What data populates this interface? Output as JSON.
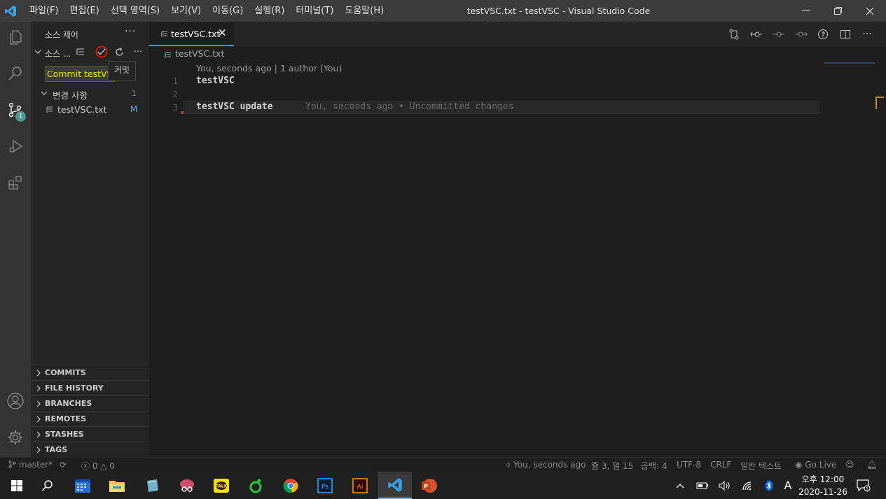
{
  "window": {
    "title": "testVSC.txt - testVSC - Visual Studio Code",
    "menu": [
      "파일(F)",
      "편집(E)",
      "선택 영역(S)",
      "보기(V)",
      "이동(G)",
      "실행(R)",
      "터미널(T)",
      "도움말(H)"
    ]
  },
  "activity": {
    "scm_badge": "1"
  },
  "sidebar": {
    "title": "소스 제어",
    "repo_label": "소스 ...",
    "commit_input_value": "Commit testVS",
    "tooltip": "커밋",
    "changes_label": "변경 사항",
    "changes_count": "1",
    "file": {
      "name": "testVSC.txt",
      "status": "M"
    },
    "sections": [
      "COMMITS",
      "FILE HISTORY",
      "BRANCHES",
      "REMOTES",
      "STASHES",
      "TAGS"
    ]
  },
  "editor": {
    "tab_label": "testVSC.txt",
    "breadcrumb": "testVSC.txt",
    "codelens": "You, seconds ago | 1 author (You)",
    "lines": [
      {
        "num": "1",
        "text": "testVSC"
      },
      {
        "num": "2",
        "text": ""
      },
      {
        "num": "3",
        "text": "testVSC update"
      }
    ],
    "blame": "You, seconds ago • Uncommitted changes"
  },
  "statusbar": {
    "branch": "master*",
    "errors": "0",
    "warnings": "0",
    "blame": "You, seconds ago",
    "position": "줄 3, 열 15",
    "spaces": "공백: 4",
    "encoding": "UTF-8",
    "eol": "CRLF",
    "language": "일반 텍스트",
    "golive": "Go Live"
  },
  "taskbar": {
    "time": "오후 12:00",
    "date": "2020-11-26",
    "ime": "A",
    "notifications": "1"
  },
  "colors": {
    "accent": "#4e94ce",
    "commit_text": "#e6e600",
    "annotation_red": "#e51400",
    "modified": "#6fa0d8"
  }
}
